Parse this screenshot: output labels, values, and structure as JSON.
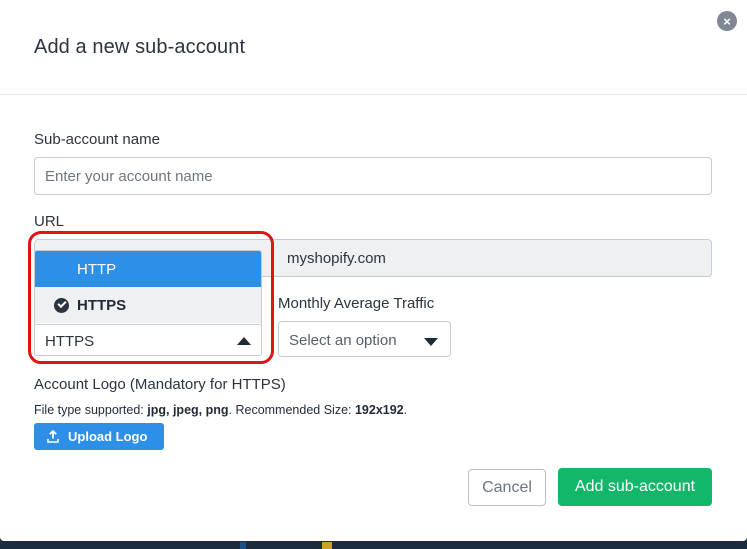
{
  "modal": {
    "title": "Add a new sub-account",
    "close_glyph": "×"
  },
  "form": {
    "account_name": {
      "label": "Sub-account name",
      "placeholder": "Enter your account name",
      "value": ""
    },
    "url": {
      "label": "URL",
      "suffix": "myshopify.com"
    },
    "protocol": {
      "options": [
        "HTTP",
        "HTTPS"
      ],
      "highlighted": "HTTP",
      "selected": "HTTPS"
    },
    "traffic": {
      "label": "Monthly Average Traffic",
      "placeholder": "Select an option"
    },
    "logo": {
      "label": "Account Logo (Mandatory for HTTPS)",
      "help_prefix": "File type supported: ",
      "help_types": "jpg, jpeg, png",
      "help_middle": ". Recommended Size: ",
      "help_size": "192x192",
      "help_suffix": ".",
      "upload_label": "Upload Logo"
    }
  },
  "footer": {
    "cancel_label": "Cancel",
    "submit_label": "Add sub-account"
  },
  "colors": {
    "primary": "#2d8fe6",
    "success": "#12b76a",
    "annotation_ring": "#e01414"
  },
  "icons": [
    "close-icon",
    "check-circle-icon",
    "caret-up-icon",
    "caret-down-icon",
    "upload-icon"
  ]
}
